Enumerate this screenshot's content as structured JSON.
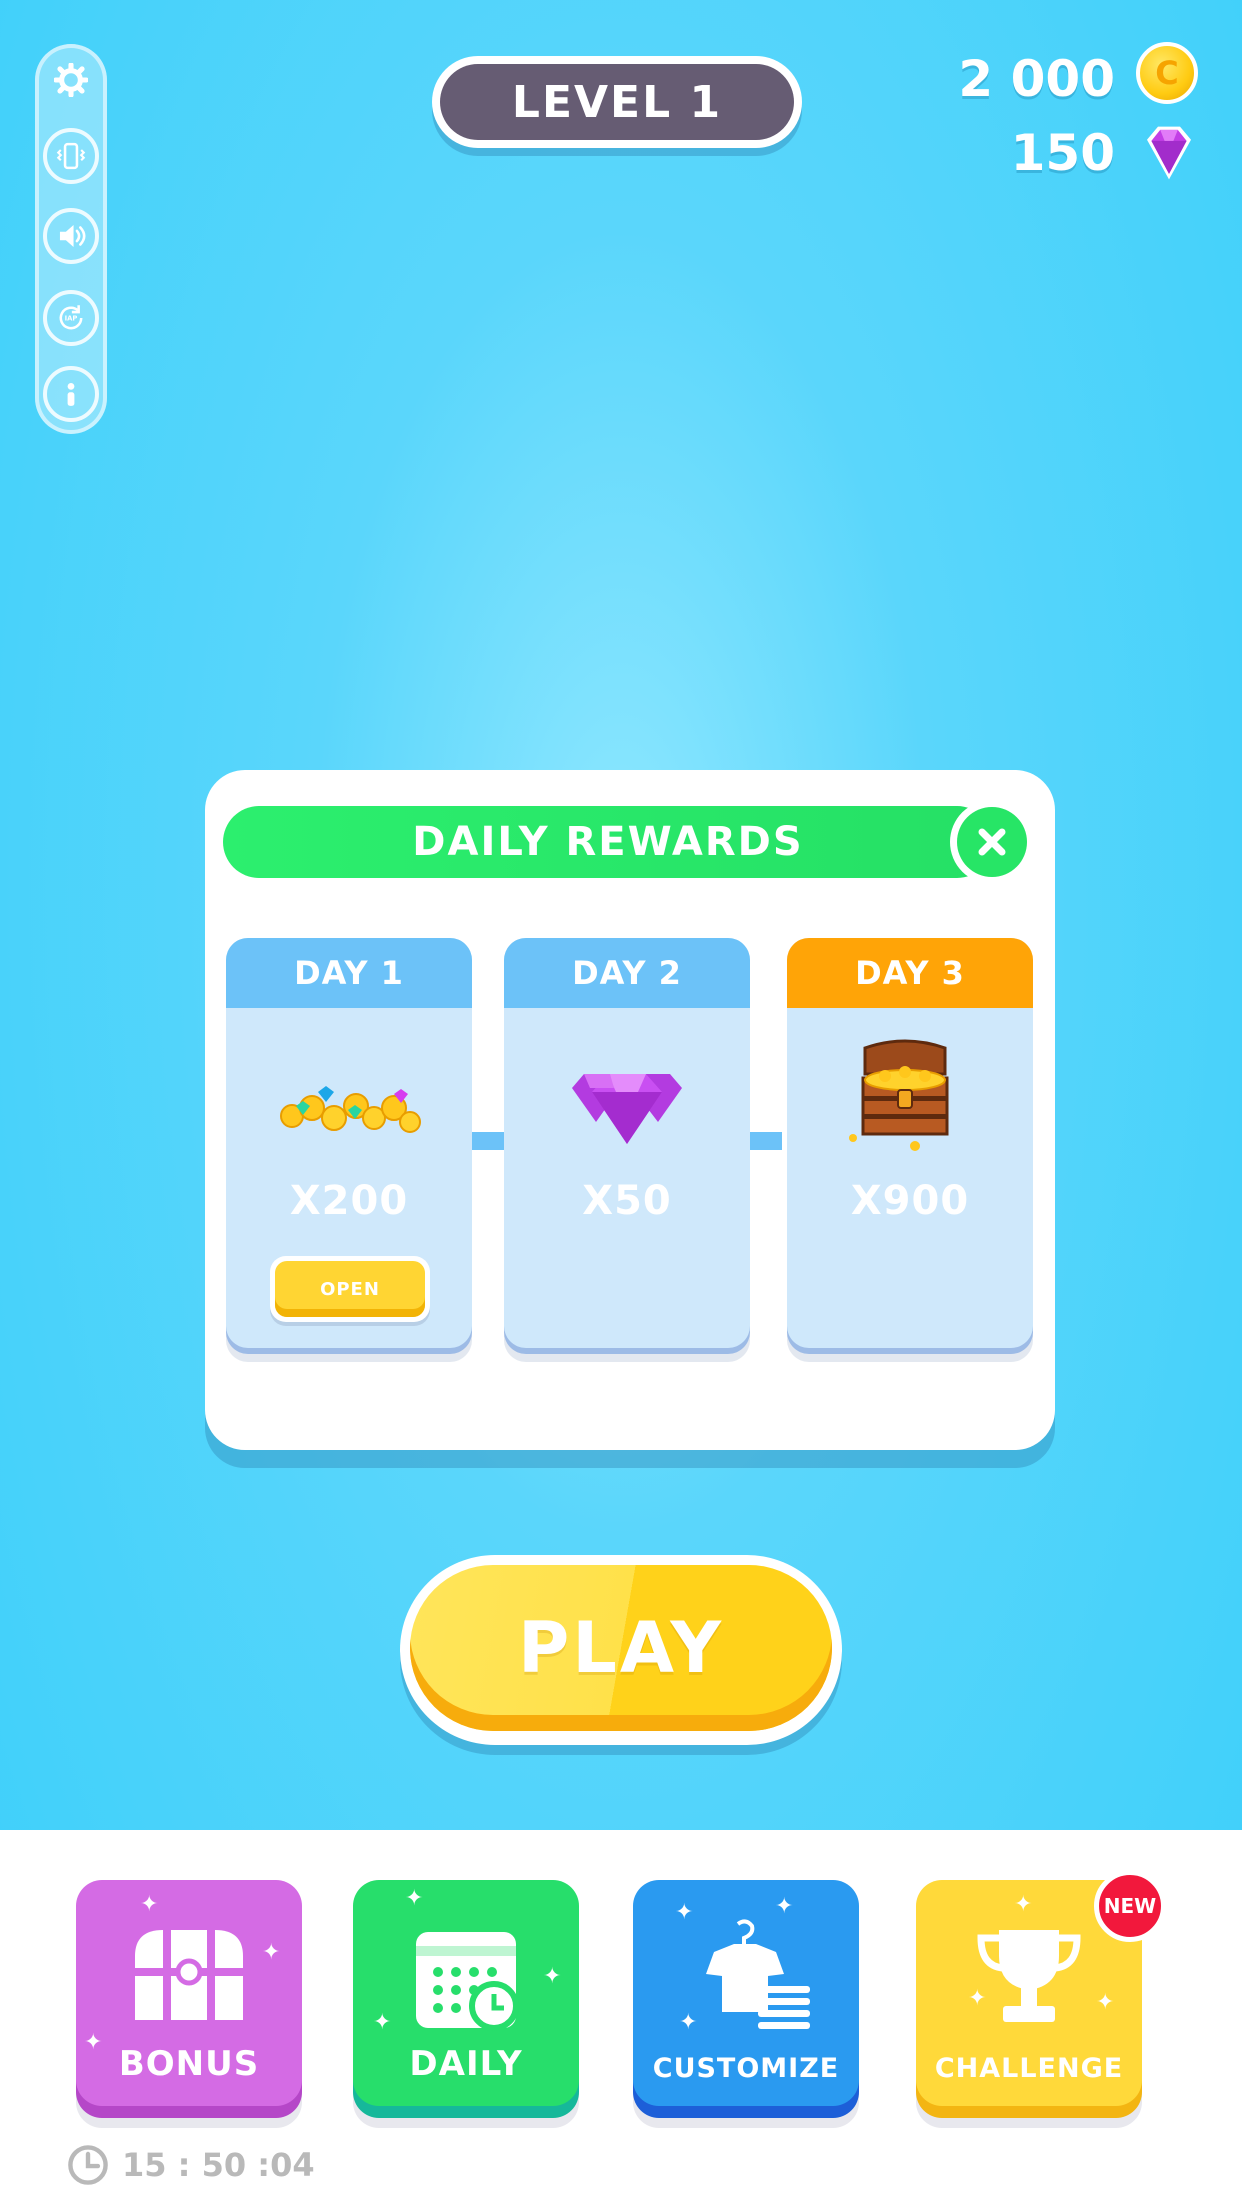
{
  "header": {
    "level_label": "LEVEL 1",
    "coins": "2 000",
    "coin_symbol": "C",
    "gems": "150"
  },
  "side_menu": {
    "items": [
      {
        "icon": "gear-icon"
      },
      {
        "icon": "vibration-icon"
      },
      {
        "icon": "sound-icon"
      },
      {
        "icon": "iap-restore-icon",
        "label": "IAP"
      },
      {
        "icon": "info-icon"
      }
    ]
  },
  "daily_rewards": {
    "title": "DAILY REWARDS",
    "days": [
      {
        "label": "DAY 1",
        "amount": "X200",
        "reward_icon": "coins-and-gems-icon",
        "button": "OPEN"
      },
      {
        "label": "DAY 2",
        "amount": "X50",
        "reward_icon": "gems-pile-icon"
      },
      {
        "label": "DAY 3",
        "amount": "X900",
        "reward_icon": "treasure-chest-icon"
      }
    ]
  },
  "play_label": "PLAY",
  "bottom_nav": {
    "tiles": [
      {
        "label": "BONUS",
        "color": "#d46be4"
      },
      {
        "label": "DAILY",
        "color": "#27de6b"
      },
      {
        "label": "CUSTOMIZE",
        "color": "#2a9af0"
      },
      {
        "label": "CHALLENGE",
        "color": "#ffd93a"
      }
    ],
    "new_badge": "NEW",
    "timer": "15 : 50 :04"
  },
  "colors": {
    "background": "#3bcffa",
    "modal_header": "#27e566",
    "day_head": "#6cc2f8",
    "day_head_active": "#ffa407",
    "play": "#ffd21a",
    "level_pill": "#665c73"
  }
}
